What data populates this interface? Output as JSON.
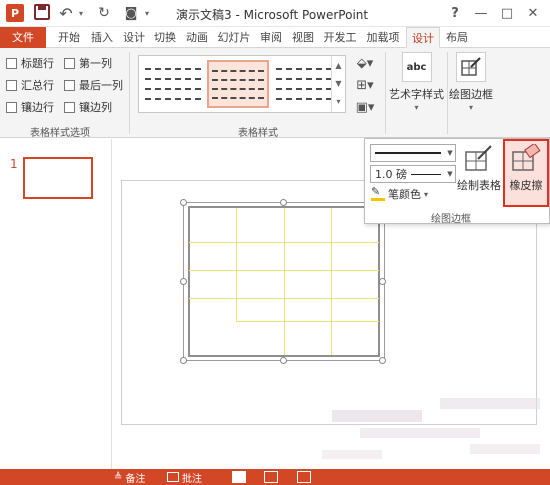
{
  "window": {
    "title": "演示文稿3 - Microsoft PowerPoint",
    "app_logo": "P",
    "help": "?",
    "minimize": "—",
    "restore": "□",
    "close": "✕"
  },
  "tabs": [
    {
      "label": "文件"
    },
    {
      "label": "开始"
    },
    {
      "label": "插入"
    },
    {
      "label": "设计"
    },
    {
      "label": "切换"
    },
    {
      "label": "动画"
    },
    {
      "label": "幻灯片"
    },
    {
      "label": "审阅"
    },
    {
      "label": "视图"
    },
    {
      "label": "开发工"
    },
    {
      "label": "加载项"
    },
    {
      "label": "设计"
    },
    {
      "label": "布局"
    }
  ],
  "table_style_options": {
    "items": [
      "标题行",
      "第一列",
      "汇总行",
      "最后一列",
      "镶边行",
      "镶边列"
    ],
    "group_label": "表格样式选项"
  },
  "table_styles": {
    "group_label": "表格样式"
  },
  "ribbon_buttons": {
    "art_text": {
      "label": "艺术字样式",
      "icon_text": "abc"
    },
    "draw_borders": {
      "label": "绘图边框"
    }
  },
  "draw_borders_popup": {
    "pen_weight": "1.0 磅",
    "pen_color": "笔颜色",
    "draw_table": "绘制表格",
    "eraser": "橡皮擦",
    "group_label": "绘图边框"
  },
  "slides_pane": {
    "slide_number": "1"
  },
  "statusbar": {
    "notes": "备注",
    "comments": "批注"
  },
  "colors": {
    "accent": "#d24726",
    "eraser_highlight": "#e03020",
    "table_lines": "#f0e27a"
  }
}
